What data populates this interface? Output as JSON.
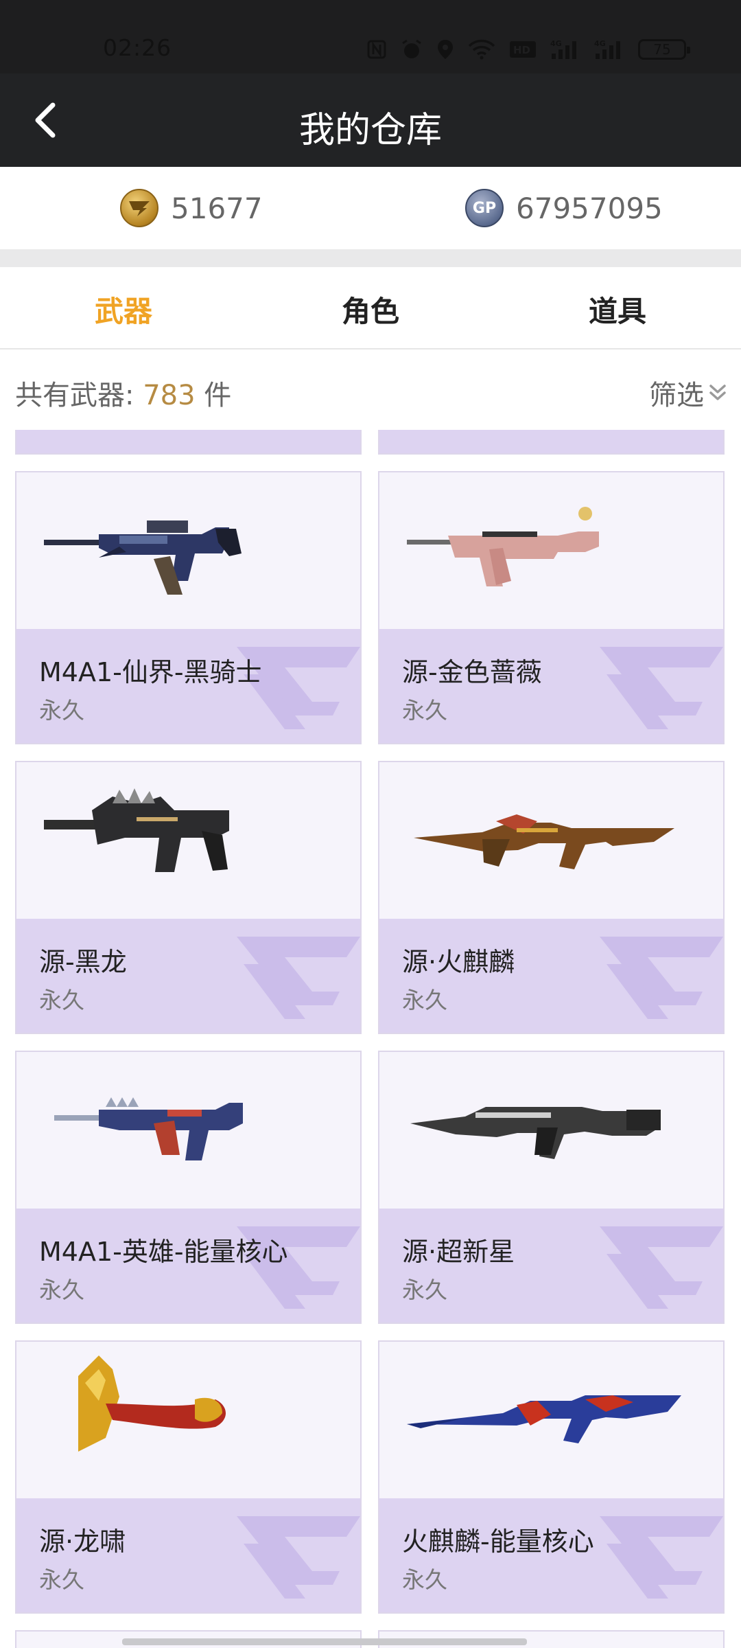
{
  "status": {
    "time": "02:26",
    "battery": "75"
  },
  "nav": {
    "title": "我的仓库"
  },
  "currency": {
    "cf_points": "51677",
    "gp_points": "67957095",
    "gp_label": "GP"
  },
  "tabs": [
    {
      "label": "武器",
      "active": true
    },
    {
      "label": "角色",
      "active": false
    },
    {
      "label": "道具",
      "active": false
    }
  ],
  "summary": {
    "prefix": "共有武器:",
    "count": "783",
    "unit": "件",
    "filter_label": "筛选"
  },
  "items": [
    {
      "name": "M4A1-仙界-黑骑士",
      "duration": "永久"
    },
    {
      "name": "源-金色蔷薇",
      "duration": "永久"
    },
    {
      "name": "源-黑龙",
      "duration": "永久"
    },
    {
      "name": "源·火麒麟",
      "duration": "永久"
    },
    {
      "name": "M4A1-英雄-能量核心",
      "duration": "永久"
    },
    {
      "name": "源·超新星",
      "duration": "永久"
    },
    {
      "name": "源·龙啸",
      "duration": "永久"
    },
    {
      "name": "火麒麟-能量核心",
      "duration": "永久"
    }
  ],
  "colors": {
    "accent": "#f0a324",
    "count": "#b68b43",
    "card_band": "#ddd3f1",
    "nav_bg": "#222325"
  }
}
